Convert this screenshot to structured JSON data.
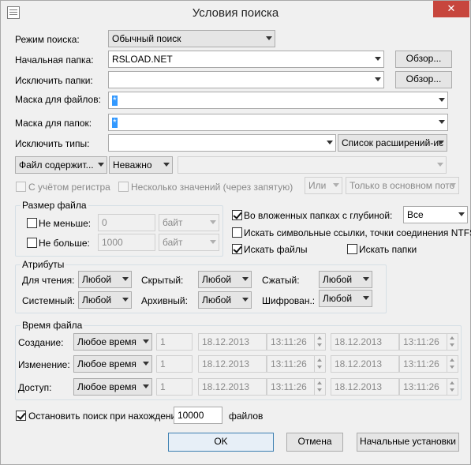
{
  "window": {
    "title": "Условия поиска",
    "close_glyph": "✕"
  },
  "labels": {
    "mode": "Режим поиска:",
    "start_folder": "Начальная папка:",
    "exclude_folders": "Исключить папки:",
    "file_mask": "Маска для файлов:",
    "folder_mask": "Маска для папок:",
    "exclude_types": "Исключить типы:"
  },
  "mode_value": "Обычный поиск",
  "start_folder_value": "RSLOAD.NET",
  "exclude_folders_value": "",
  "file_mask_value": "*",
  "folder_mask_value": "*",
  "exclude_types_value": "",
  "browse_label": "Обзор...",
  "ext_list_value": "Список расширений-ис",
  "content": {
    "type_value": "Файл содержит...",
    "importance_value": "Неважно",
    "text_value": "",
    "case_label": "С учётом регистра",
    "multi_label": "Несколько значений (через запятую)",
    "or_value": "Или",
    "stream_value": "Только в основном пото"
  },
  "size": {
    "group_title": "Размер файла",
    "min_label": "Не меньше:",
    "min_value": "0",
    "min_unit": "байт",
    "max_label": "Не больше:",
    "max_value": "1000",
    "max_unit": "байт"
  },
  "options": {
    "subfolders_label": "Во вложенных папках с глубиной:",
    "subfolders_checked": true,
    "depth_value": "Все",
    "symlinks_label": "Искать символьные ссылки, точки соединения NTFS",
    "symlinks_checked": false,
    "find_files_label": "Искать файлы",
    "find_files_checked": true,
    "find_folders_label": "Искать папки",
    "find_folders_checked": false
  },
  "attributes": {
    "group_title": "Атрибуты",
    "readonly_label": "Для чтения:",
    "readonly_value": "Любой",
    "hidden_label": "Скрытый:",
    "hidden_value": "Любой",
    "compressed_label": "Сжатый:",
    "compressed_value": "Любой",
    "system_label": "Системный:",
    "system_value": "Любой",
    "archive_label": "Архивный:",
    "archive_value": "Любой",
    "encrypted_label": "Шифрован.:",
    "encrypted_value": "Любой"
  },
  "filetime": {
    "group_title": "Время файла",
    "rows": [
      {
        "label": "Создание:",
        "mode": "Любое время",
        "num": "1",
        "date1": "18.12.2013",
        "time1": "13:11:26",
        "date2": "18.12.2013",
        "time2": "13:11:26"
      },
      {
        "label": "Изменение:",
        "mode": "Любое время",
        "num": "1",
        "date1": "18.12.2013",
        "time1": "13:11:26",
        "date2": "18.12.2013",
        "time2": "13:11:26"
      },
      {
        "label": "Доступ:",
        "mode": "Любое время",
        "num": "1",
        "date1": "18.12.2013",
        "time1": "13:11:26",
        "date2": "18.12.2013",
        "time2": "13:11:26"
      }
    ]
  },
  "stop": {
    "label": "Остановить поиск при нахождении",
    "checked": true,
    "value": "10000",
    "suffix": "файлов"
  },
  "buttons": {
    "ok": "OK",
    "cancel": "Отмена",
    "defaults": "Начальные установки"
  }
}
